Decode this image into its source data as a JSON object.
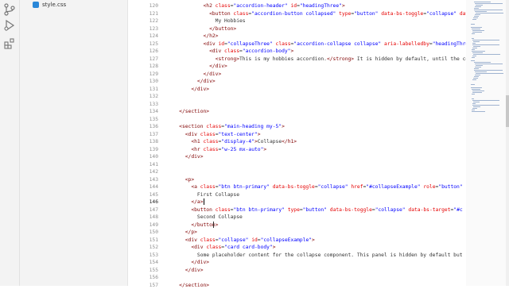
{
  "explorer": {
    "file_name": "style.css"
  },
  "activity_icons": [
    "source-control-icon",
    "run-debug-icon",
    "extensions-icon"
  ],
  "lines": [
    {
      "num": "120",
      "indent": "            ",
      "parts": [
        [
          "tag",
          "<h2 "
        ],
        [
          "attr",
          "class"
        ],
        [
          "txt",
          "="
        ],
        [
          "val",
          "\"accordion-header\""
        ],
        [
          "attr",
          " id"
        ],
        [
          "txt",
          "="
        ],
        [
          "val",
          "\"headingThree\""
        ],
        [
          "tag",
          ">"
        ]
      ]
    },
    {
      "num": "121",
      "indent": "              ",
      "parts": [
        [
          "tag",
          "<button "
        ],
        [
          "attr",
          "class"
        ],
        [
          "txt",
          "="
        ],
        [
          "val",
          "\"accordion-button collapsed\""
        ],
        [
          "attr",
          " type"
        ],
        [
          "txt",
          "="
        ],
        [
          "val",
          "\"button\""
        ],
        [
          "attr",
          " data-bs-toggle"
        ],
        [
          "txt",
          "="
        ],
        [
          "val",
          "\"collapse\""
        ],
        [
          "attr",
          " data"
        ]
      ]
    },
    {
      "num": "122",
      "indent": "                ",
      "parts": [
        [
          "txt",
          "My Hobbies"
        ]
      ]
    },
    {
      "num": "123",
      "indent": "              ",
      "parts": [
        [
          "tag",
          "</button>"
        ]
      ]
    },
    {
      "num": "124",
      "indent": "            ",
      "parts": [
        [
          "tag",
          "</h2>"
        ]
      ]
    },
    {
      "num": "125",
      "indent": "            ",
      "parts": [
        [
          "tag",
          "<div "
        ],
        [
          "attr",
          "id"
        ],
        [
          "txt",
          "="
        ],
        [
          "val",
          "\"collapseThree\""
        ],
        [
          "attr",
          " class"
        ],
        [
          "txt",
          "="
        ],
        [
          "val",
          "\"accordion-collapse collapse\""
        ],
        [
          "attr",
          " aria-labelledby"
        ],
        [
          "txt",
          "="
        ],
        [
          "val",
          "\"headingThree\""
        ]
      ]
    },
    {
      "num": "126",
      "indent": "              ",
      "parts": [
        [
          "tag",
          "<div "
        ],
        [
          "attr",
          "class"
        ],
        [
          "txt",
          "="
        ],
        [
          "val",
          "\"accordion-body\""
        ],
        [
          "tag",
          ">"
        ]
      ]
    },
    {
      "num": "127",
      "indent": "                ",
      "parts": [
        [
          "tag",
          "<strong>"
        ],
        [
          "txt",
          "This is my hobbies accordion."
        ],
        [
          "tag",
          "</strong>"
        ],
        [
          "txt",
          " It is hidden by default, until the co"
        ]
      ]
    },
    {
      "num": "128",
      "indent": "              ",
      "parts": [
        [
          "tag",
          "</div>"
        ]
      ]
    },
    {
      "num": "129",
      "indent": "            ",
      "parts": [
        [
          "tag",
          "</div>"
        ]
      ]
    },
    {
      "num": "130",
      "indent": "          ",
      "parts": [
        [
          "tag",
          "</div>"
        ]
      ]
    },
    {
      "num": "131",
      "indent": "        ",
      "parts": [
        [
          "tag",
          "</div>"
        ]
      ]
    },
    {
      "num": "132",
      "indent": "",
      "parts": []
    },
    {
      "num": "133",
      "indent": "",
      "parts": []
    },
    {
      "num": "134",
      "indent": "    ",
      "parts": [
        [
          "tag",
          "</section>"
        ]
      ]
    },
    {
      "num": "135",
      "indent": "",
      "parts": []
    },
    {
      "num": "136",
      "indent": "    ",
      "parts": [
        [
          "tag",
          "<section "
        ],
        [
          "attr",
          "class"
        ],
        [
          "txt",
          "="
        ],
        [
          "val",
          "\"main-heading my-5\""
        ],
        [
          "tag",
          ">"
        ]
      ]
    },
    {
      "num": "137",
      "indent": "      ",
      "parts": [
        [
          "tag",
          "<div "
        ],
        [
          "attr",
          "class"
        ],
        [
          "txt",
          "="
        ],
        [
          "val",
          "\"text-center\""
        ],
        [
          "tag",
          ">"
        ]
      ]
    },
    {
      "num": "138",
      "indent": "        ",
      "parts": [
        [
          "tag",
          "<h1 "
        ],
        [
          "attr",
          "class"
        ],
        [
          "txt",
          "="
        ],
        [
          "val",
          "\"display-4\""
        ],
        [
          "tag",
          ">"
        ],
        [
          "txt",
          "Collapse"
        ],
        [
          "tag",
          "</h1>"
        ]
      ]
    },
    {
      "num": "139",
      "indent": "        ",
      "parts": [
        [
          "tag",
          "<hr "
        ],
        [
          "attr",
          "class"
        ],
        [
          "txt",
          "="
        ],
        [
          "val",
          "\"w-25 mx-auto\""
        ],
        [
          "tag",
          ">"
        ]
      ]
    },
    {
      "num": "140",
      "indent": "      ",
      "parts": [
        [
          "tag",
          "</div>"
        ]
      ]
    },
    {
      "num": "141",
      "indent": "",
      "parts": []
    },
    {
      "num": "142",
      "indent": "",
      "parts": []
    },
    {
      "num": "143",
      "indent": "      ",
      "parts": [
        [
          "tag",
          "<p>"
        ]
      ]
    },
    {
      "num": "144",
      "indent": "        ",
      "parts": [
        [
          "tag",
          "<a "
        ],
        [
          "attr",
          "class"
        ],
        [
          "txt",
          "="
        ],
        [
          "val",
          "\"btn btn-primary\""
        ],
        [
          "attr",
          " data-bs-toggle"
        ],
        [
          "txt",
          "="
        ],
        [
          "val",
          "\"collapse\""
        ],
        [
          "attr",
          " href"
        ],
        [
          "txt",
          "="
        ],
        [
          "val",
          "\"#collapseExample\""
        ],
        [
          "attr",
          " role"
        ],
        [
          "txt",
          "="
        ],
        [
          "val",
          "\"button\""
        ]
      ]
    },
    {
      "num": "145",
      "indent": "          ",
      "parts": [
        [
          "txt",
          "First Collapse"
        ]
      ]
    },
    {
      "num": "146",
      "indent": "        ",
      "parts": [
        [
          "tag",
          "</a>"
        ]
      ]
    },
    {
      "num": "147",
      "indent": "        ",
      "parts": [
        [
          "tag",
          "<button "
        ],
        [
          "attr",
          "class"
        ],
        [
          "txt",
          "="
        ],
        [
          "val",
          "\"btn btn-primary\""
        ],
        [
          "attr",
          " type"
        ],
        [
          "txt",
          "="
        ],
        [
          "val",
          "\"button\""
        ],
        [
          "attr",
          " data-bs-toggle"
        ],
        [
          "txt",
          "="
        ],
        [
          "val",
          "\"collapse\""
        ],
        [
          "attr",
          " data-bs-target"
        ],
        [
          "txt",
          "="
        ],
        [
          "val",
          "\"#c"
        ]
      ]
    },
    {
      "num": "148",
      "indent": "          ",
      "parts": [
        [
          "txt",
          "Second Collapse"
        ]
      ]
    },
    {
      "num": "149",
      "indent": "        ",
      "parts": [
        [
          "tag",
          "</button>"
        ]
      ]
    },
    {
      "num": "150",
      "indent": "      ",
      "parts": [
        [
          "tag",
          "</p>"
        ]
      ]
    },
    {
      "num": "151",
      "indent": "      ",
      "parts": [
        [
          "tag",
          "<div "
        ],
        [
          "attr",
          "class"
        ],
        [
          "txt",
          "="
        ],
        [
          "val",
          "\"collapse\""
        ],
        [
          "attr",
          " id"
        ],
        [
          "txt",
          "="
        ],
        [
          "val",
          "\"collapseExample\""
        ],
        [
          "tag",
          ">"
        ]
      ]
    },
    {
      "num": "152",
      "indent": "        ",
      "parts": [
        [
          "tag",
          "<div "
        ],
        [
          "attr",
          "class"
        ],
        [
          "txt",
          "="
        ],
        [
          "val",
          "\"card card-body\""
        ],
        [
          "tag",
          ">"
        ]
      ]
    },
    {
      "num": "153",
      "indent": "          ",
      "parts": [
        [
          "txt",
          "Some placeholder content for the collapse component. This panel is hidden by default but"
        ]
      ]
    },
    {
      "num": "154",
      "indent": "        ",
      "parts": [
        [
          "tag",
          "</div>"
        ]
      ]
    },
    {
      "num": "155",
      "indent": "      ",
      "parts": [
        [
          "tag",
          "</div>"
        ]
      ]
    },
    {
      "num": "156",
      "indent": "",
      "parts": []
    },
    {
      "num": "157",
      "indent": "    ",
      "parts": [
        [
          "tag",
          "</section>"
        ]
      ]
    }
  ],
  "active_line": "146",
  "colors": {
    "tag": "#800000",
    "attr": "#e50000",
    "value": "#0000ff",
    "text": "#333333"
  }
}
